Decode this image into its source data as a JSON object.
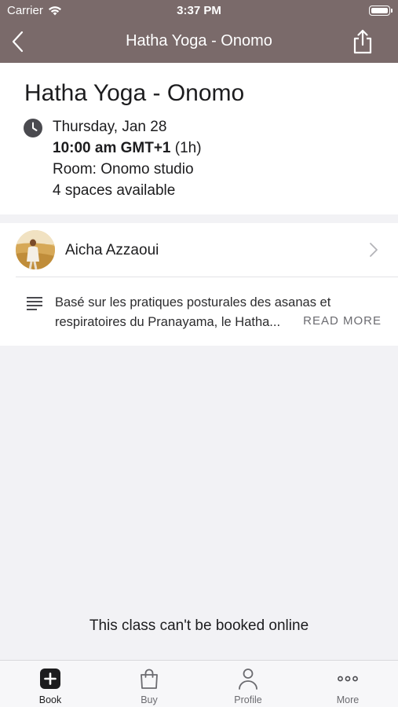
{
  "status_bar": {
    "carrier": "Carrier",
    "time": "3:37 PM"
  },
  "nav": {
    "title": "Hatha Yoga - Onomo"
  },
  "class": {
    "title": "Hatha Yoga - Onomo",
    "date": "Thursday, Jan 28",
    "time": "10:00 am GMT+1",
    "duration": "(1h)",
    "room": "Room: Onomo studio",
    "spaces": "4 spaces available"
  },
  "instructor": {
    "name": "Aicha Azzaoui"
  },
  "description": {
    "text": "Basé sur les pratiques posturales des asanas et respiratoires du Pranayama, le Hatha...",
    "read_more": "READ MORE"
  },
  "booking_message": "This class can't be booked online",
  "tabs": [
    {
      "label": "Book",
      "icon": "plus-square-icon",
      "active": true
    },
    {
      "label": "Buy",
      "icon": "bag-icon",
      "active": false
    },
    {
      "label": "Profile",
      "icon": "person-icon",
      "active": false
    },
    {
      "label": "More",
      "icon": "ellipsis-icon",
      "active": false
    }
  ],
  "colors": {
    "nav_bar": "#7a6a6a",
    "background": "#f2f2f5",
    "card": "#ffffff"
  }
}
